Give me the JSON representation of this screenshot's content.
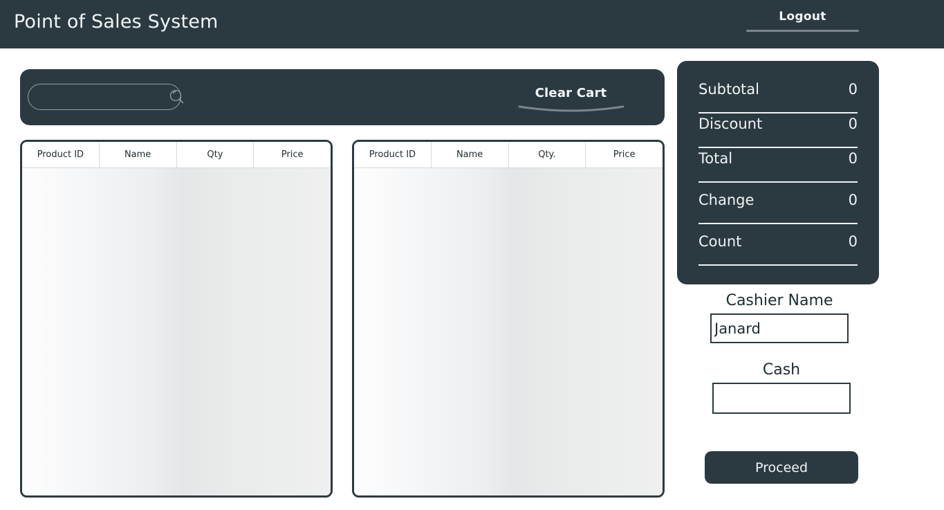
{
  "header": {
    "title": "Point of Sales System",
    "logout_label": "Logout"
  },
  "toolbar": {
    "search_placeholder": "",
    "search_value": "",
    "search_icon": "search-icon",
    "clear_cart_label": "Clear Cart"
  },
  "tables": {
    "product_table": {
      "columns": [
        "Product ID",
        "Name",
        "Qty",
        "Price"
      ],
      "rows": []
    },
    "cart_table": {
      "columns": [
        "Product ID",
        "Name",
        "Qty.",
        "Price"
      ],
      "rows": []
    }
  },
  "summary": {
    "rows": [
      {
        "label": "Subtotal",
        "value": "0"
      },
      {
        "label": "Discount",
        "value": "0"
      },
      {
        "label": "Total",
        "value": "0"
      },
      {
        "label": "Change",
        "value": "0"
      },
      {
        "label": "Count",
        "value": "0"
      }
    ]
  },
  "fields": {
    "cashier_label": "Cashier Name",
    "cashier_value": "Janard",
    "cashier_placeholder": "",
    "cash_label": "Cash",
    "cash_value": "",
    "cash_placeholder": ""
  },
  "actions": {
    "proceed_label": "Proceed"
  },
  "colors": {
    "dark": "#2b3a41",
    "light_text": "#f0f3f4",
    "divider": "#d6d9da",
    "accent_underline": "#7b878c"
  }
}
